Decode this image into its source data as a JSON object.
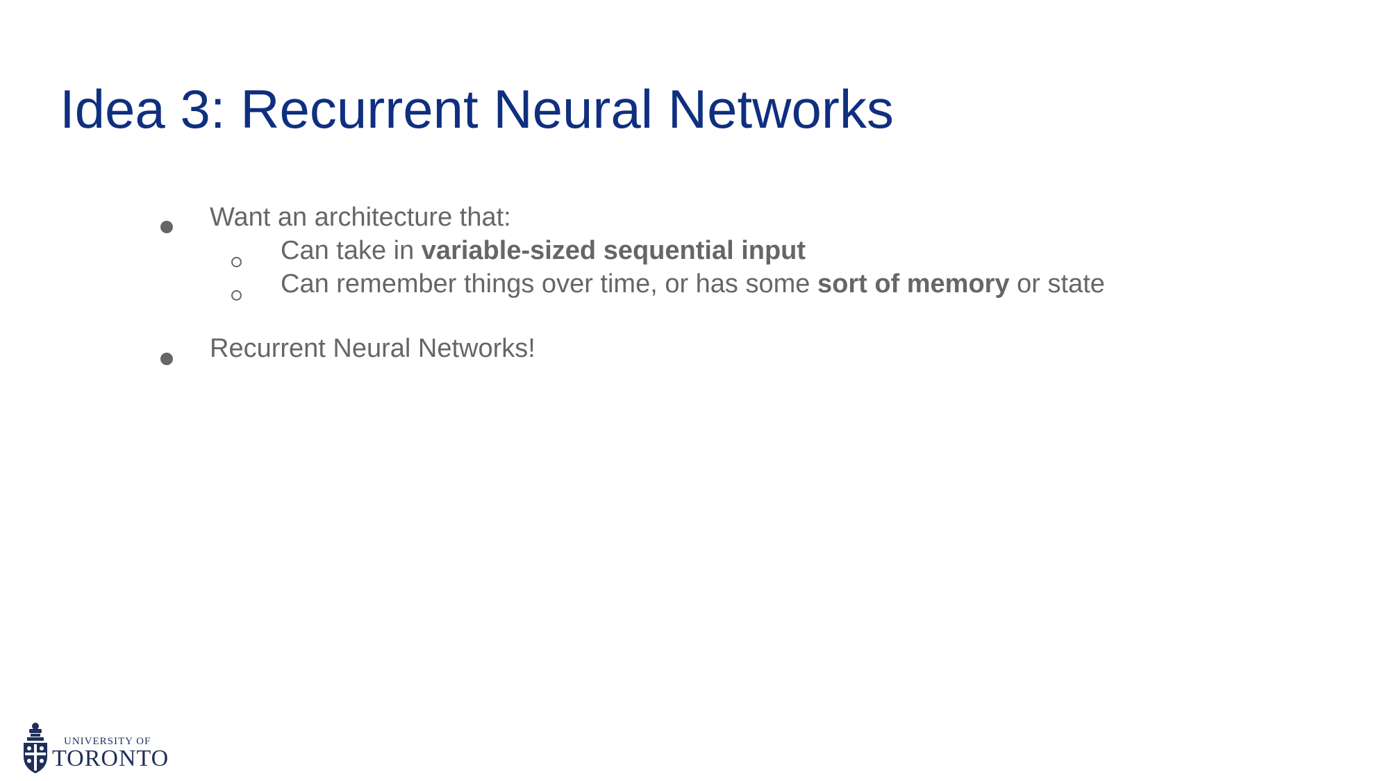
{
  "slide": {
    "title": "Idea 3: Recurrent Neural Networks",
    "bullets": [
      {
        "text": "Want an architecture that:",
        "subbullets": [
          {
            "prefix": "Can take in ",
            "bold": "variable-sized sequential input",
            "suffix": ""
          },
          {
            "prefix": "Can remember things over time, or has some ",
            "bold": "sort of memory",
            "suffix": " or state"
          }
        ]
      },
      {
        "text": "Recurrent Neural Networks!"
      }
    ]
  },
  "logo": {
    "line1": "UNIVERSITY OF",
    "line2": "TORONTO"
  },
  "colors": {
    "title": "#0f2f7f",
    "body_text": "#666666",
    "logo": "#1f2f5a"
  }
}
